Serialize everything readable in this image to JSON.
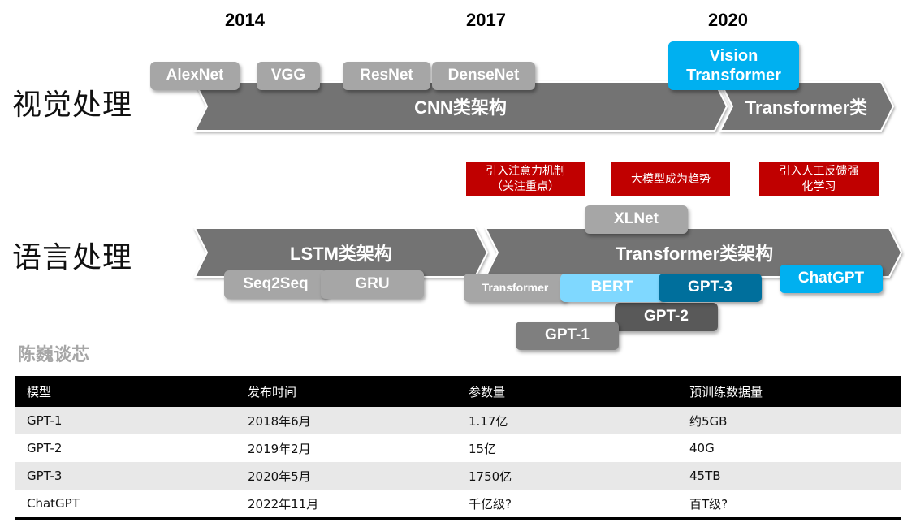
{
  "years": [
    "2014",
    "2017",
    "2020"
  ],
  "rows": {
    "vision": "视觉处理",
    "language": "语言处理"
  },
  "vision": {
    "cnn_label": "CNN类架构",
    "transformer_label": "Transformer类",
    "models": [
      "AlexNet",
      "VGG",
      "ResNet",
      "DenseNet"
    ],
    "vit_line1": "Vision",
    "vit_line2": "Transformer"
  },
  "notes": [
    {
      "line1": "引入注意力机制",
      "line2": "（关注重点）"
    },
    {
      "line1": "大模型成为趋势",
      "line2": ""
    },
    {
      "line1": "引入人工反馈强",
      "line2": "化学习"
    }
  ],
  "language": {
    "lstm_label": "LSTM类架构",
    "transformer_label": "Transformer类架构",
    "models": {
      "xlnet": "XLNet",
      "seq2seq": "Seq2Seq",
      "gru": "GRU",
      "transformer": "Transformer",
      "bert": "BERT",
      "gpt3": "GPT-3",
      "chatgpt": "ChatGPT",
      "gpt2": "GPT-2",
      "gpt1": "GPT-1"
    }
  },
  "watermark": "陈巍谈芯",
  "table": {
    "headers": [
      "模型",
      "发布时间",
      "参数量",
      "预训练数据量"
    ],
    "rows": [
      [
        "GPT-1",
        "2018年6月",
        "1.17亿",
        "约5GB"
      ],
      [
        "GPT-2",
        "2019年2月",
        "15亿",
        "40G"
      ],
      [
        "GPT-3",
        "2020年5月",
        "1750亿",
        "45TB"
      ],
      [
        "ChatGPT",
        "2022年11月",
        "千亿级?",
        "百T级?"
      ]
    ]
  },
  "colors": {
    "arrow_gray": "#737373",
    "tag_light_gray": "#a6a6a6",
    "tag_dark_gray": "#595959",
    "tag_mid_gray": "#7f7f7f",
    "blue_bright": "#00b0f0",
    "blue_light": "#7fd8ff",
    "blue_dark": "#006f9c",
    "note_red": "#c00000"
  }
}
